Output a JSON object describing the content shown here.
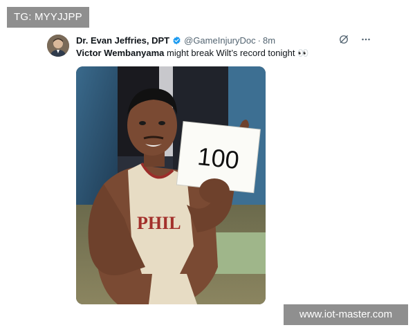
{
  "watermark_top": "TG: MYYJJPP",
  "watermark_bottom": "www.iot-master.com",
  "tweet": {
    "author": {
      "display_name": "Dr. Evan Jeffries, DPT",
      "handle": "@GameInjuryDoc",
      "separator": "·",
      "time": "8m",
      "verified": true,
      "avatar_icon": "user-avatar"
    },
    "text": {
      "mention": "Victor Wembanyama",
      "rest": " might break Wilt’s record tonight",
      "emoji": "👀"
    },
    "actions": {
      "grok_icon": "slash-circle-icon",
      "more_icon": "more-dots-icon"
    },
    "media": {
      "sign_text": "100",
      "jersey_text": "PHIL"
    }
  },
  "colors": {
    "text_primary": "#0f1419",
    "text_secondary": "#536471",
    "verified_blue": "#1d9bf0",
    "watermark_bg": "#8f8f8f"
  }
}
